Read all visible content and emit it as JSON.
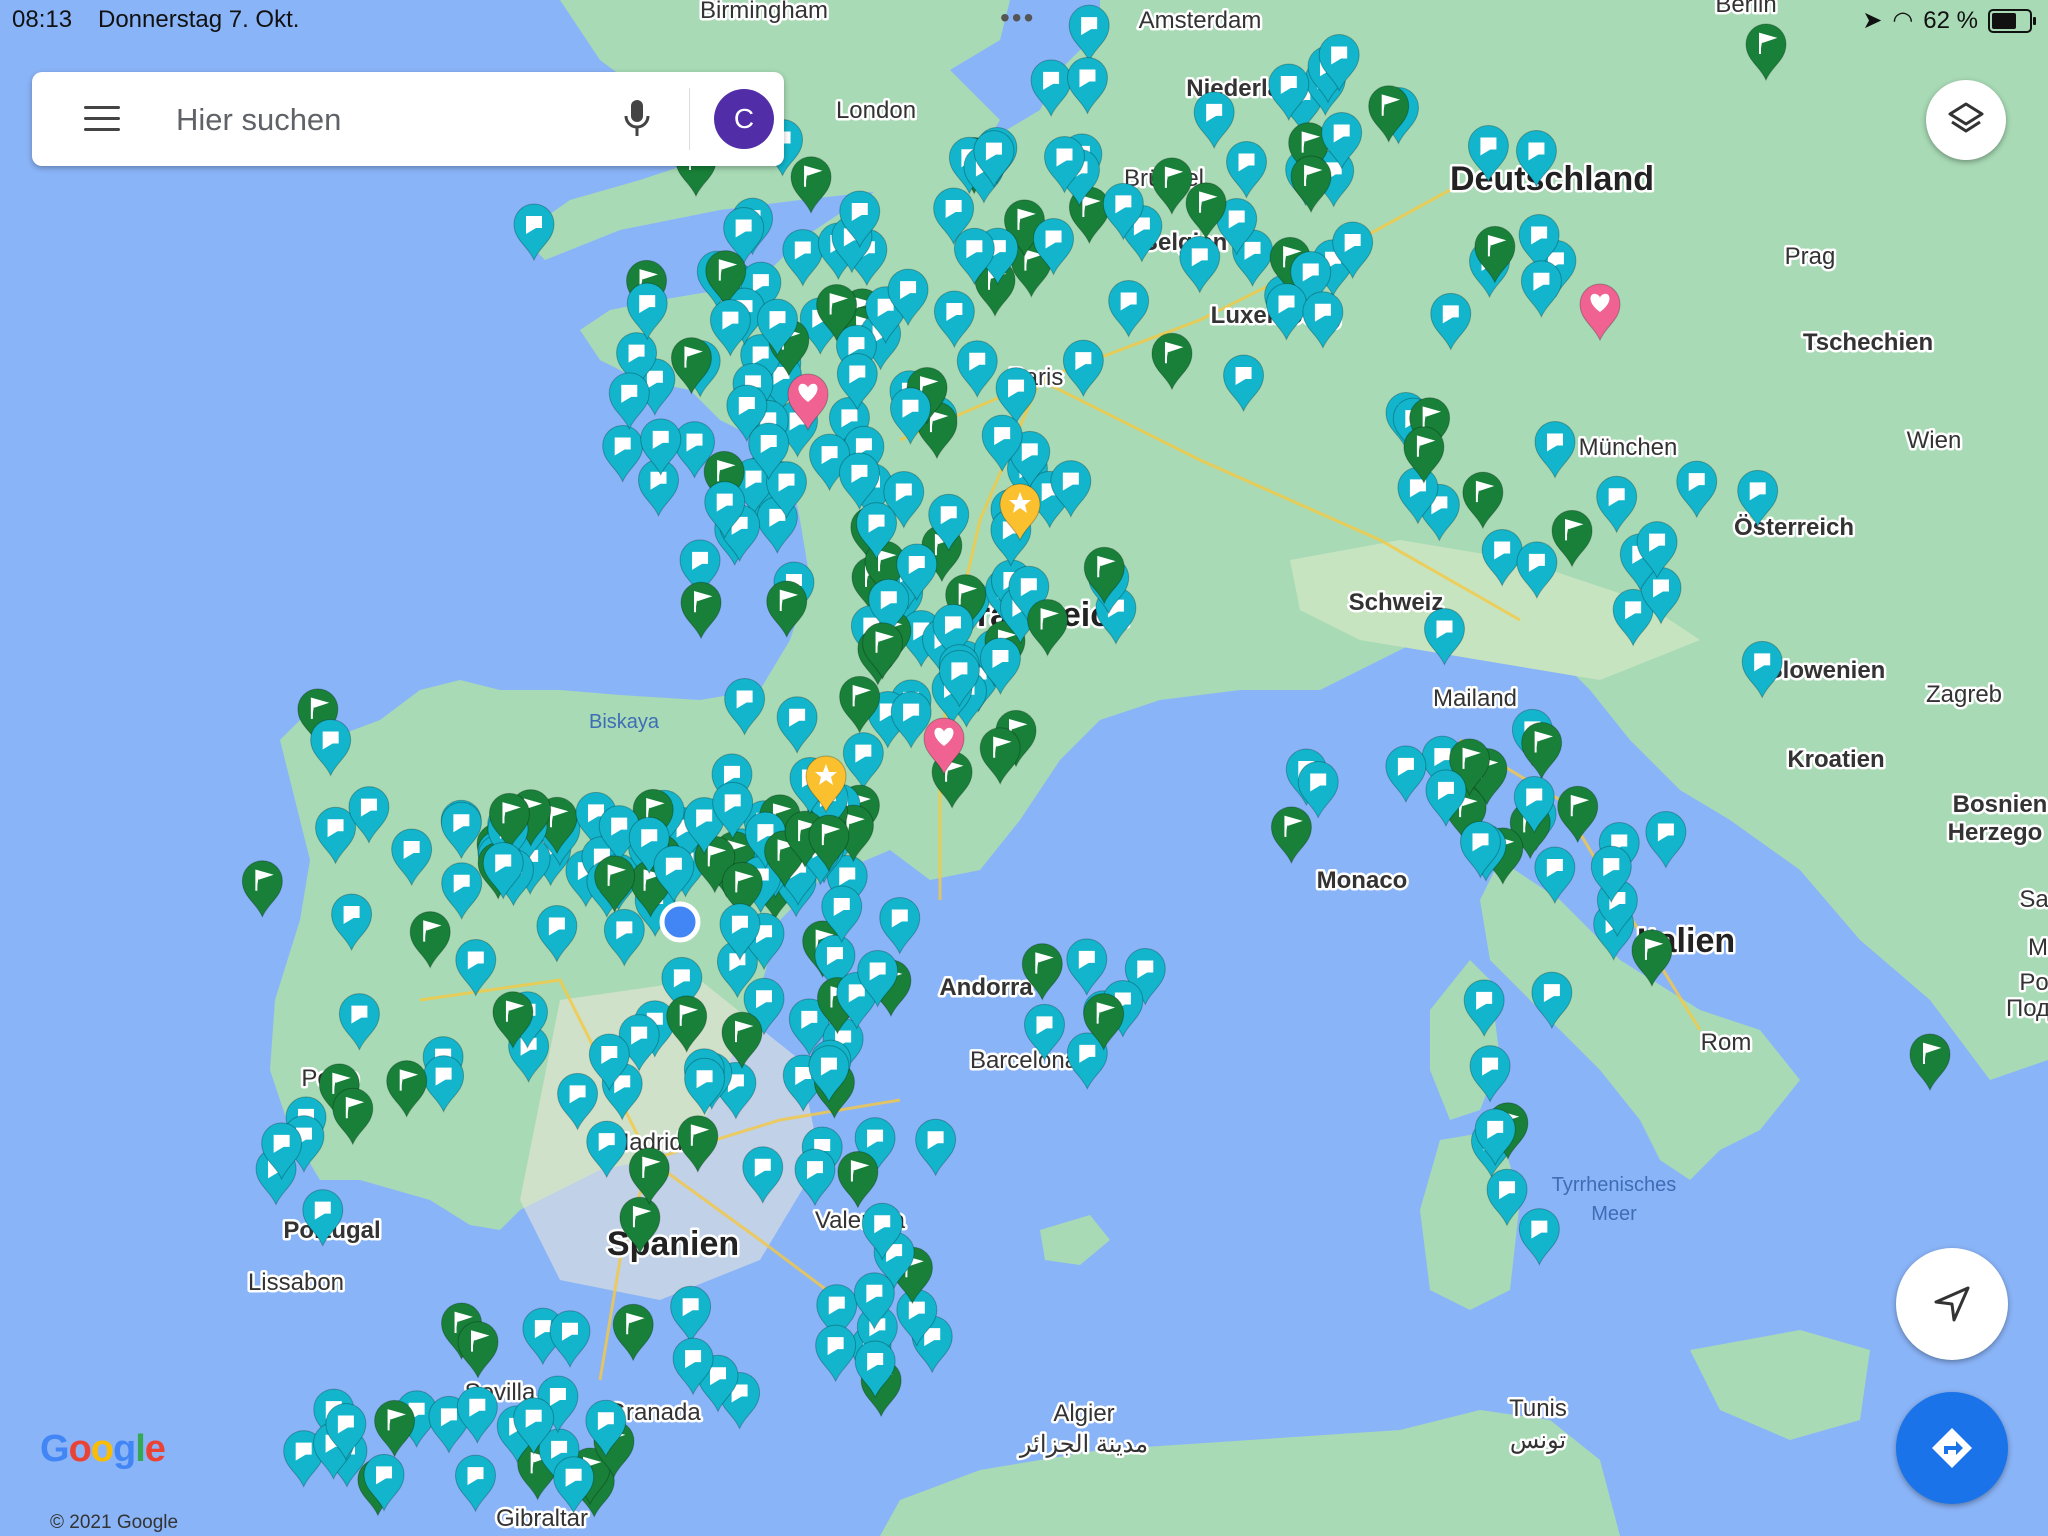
{
  "status_bar": {
    "time": "08:13",
    "date": "Donnerstag 7. Okt.",
    "battery": "62 %"
  },
  "search": {
    "placeholder": "Hier suchen",
    "avatar_letter": "C"
  },
  "map": {
    "countries": [
      {
        "name": "Deutschland"
      },
      {
        "name": "Frankreich"
      },
      {
        "name": "Spanien"
      },
      {
        "name": "Italien"
      },
      {
        "name": "Portugal"
      },
      {
        "name": "Österreich"
      },
      {
        "name": "Tschechien"
      },
      {
        "name": "Schweiz"
      },
      {
        "name": "Belgien"
      },
      {
        "name": "Niederlande"
      },
      {
        "name": "Slowenien"
      },
      {
        "name": "Kroatien"
      },
      {
        "name": "Luxemburg"
      },
      {
        "name": "Monaco"
      },
      {
        "name": "Andorra"
      },
      {
        "name": "Bosnien"
      },
      {
        "name": "Herzego"
      }
    ],
    "cities": [
      {
        "name": "Birmingham"
      },
      {
        "name": "London"
      },
      {
        "name": "Amsterdam"
      },
      {
        "name": "Berlin"
      },
      {
        "name": "Brüssel"
      },
      {
        "name": "Paris"
      },
      {
        "name": "Prag"
      },
      {
        "name": "München"
      },
      {
        "name": "Wien"
      },
      {
        "name": "Zagreb"
      },
      {
        "name": "Mailand"
      },
      {
        "name": "Rom"
      },
      {
        "name": "Barcelona"
      },
      {
        "name": "Madrid"
      },
      {
        "name": "Valencia"
      },
      {
        "name": "Porto"
      },
      {
        "name": "Lissabon"
      },
      {
        "name": "Sevilla"
      },
      {
        "name": "Granada"
      },
      {
        "name": "Gibraltar"
      },
      {
        "name": "Algier"
      },
      {
        "name": "مدينة الجزائر"
      },
      {
        "name": "Tunis"
      },
      {
        "name": "تونس"
      }
    ],
    "seas": [
      {
        "name": "Biskaya"
      },
      {
        "name": "Tyrrhenisches"
      },
      {
        "name": "Meer"
      }
    ],
    "edge_fragments": [
      "Sa",
      "M",
      "Po",
      "Под"
    ]
  },
  "footer": {
    "logo": "Google",
    "copyright": "© 2021 Google"
  },
  "colors": {
    "water": "#8ab4f8",
    "land": "#a8dab5",
    "pin_teal": "#12b5cb",
    "pin_green": "#188038",
    "pin_pink": "#f06292",
    "pin_yellow": "#fbc02d",
    "location_dot": "#4285f4"
  }
}
